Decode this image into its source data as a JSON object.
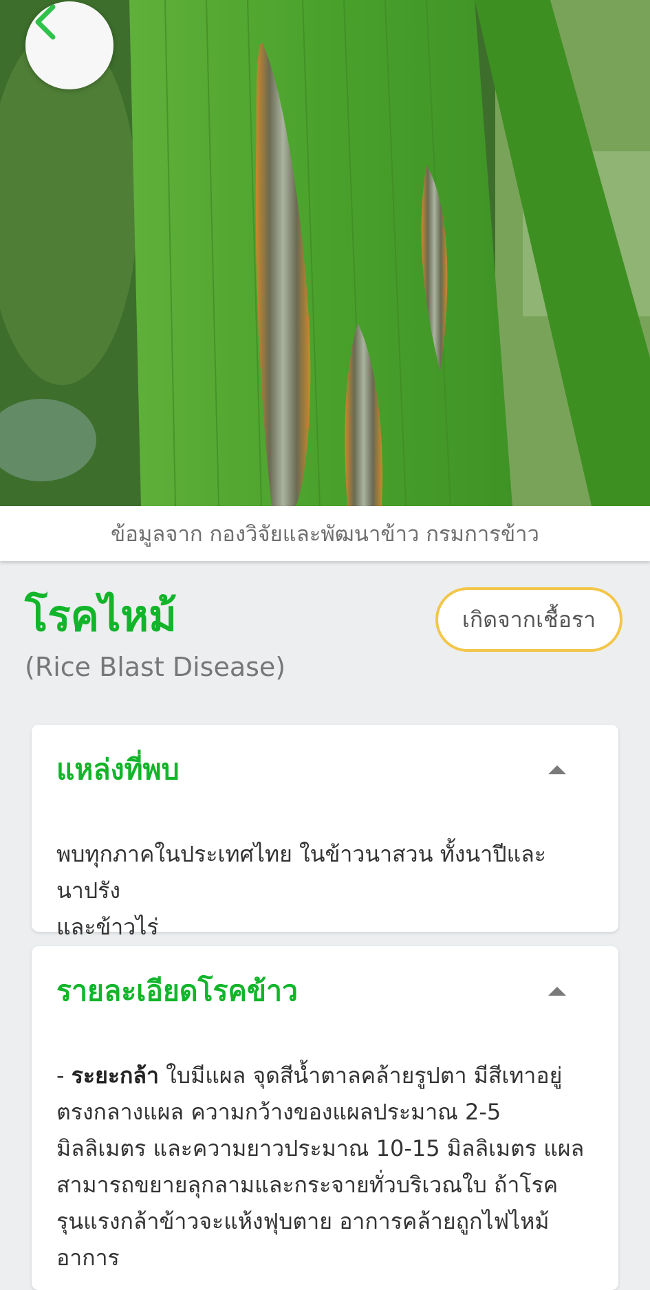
{
  "hero": {
    "image": "rice-leaf-blast-lesions",
    "back_icon": "chevron-left-icon"
  },
  "credit_text": "ข้อมูลจาก กองวิจัยและพัฒนาข้าว กรมการข้าว",
  "disease": {
    "name_th": "โรคไหม้",
    "name_en": "(Rice Blast Disease)",
    "cause_badge": "เกิดจากเชื้อรา"
  },
  "sections": [
    {
      "title": "แหล่งที่พบ",
      "expanded": true,
      "body_lines": [
        "พบทุกภาคในประเทศไทย ในข้าวนาสวน ทั้งนาปีและนาปรัง",
        "และข้าวไร่"
      ]
    },
    {
      "title": "รายละเอียดโรคข้าว",
      "expanded": true,
      "body_prefix": "- ",
      "body_bold": "ระยะกล้า",
      "body_lines": [
        " ใบมีแผล จุดสีน้ำตาลคล้ายรูปตา มีสีเทาอยู่",
        "ตรงกลางแผล ความกว้างของแผลประมาณ 2-5",
        "มิลลิเมตร และความยาวประมาณ 10-15 มิลลิเมตร แผล",
        "สามารถขยายลุกลามและกระจายทั่วบริเวณใบ ถ้าโรค",
        "รุนแรงกล้าข้าวจะแห้งฟุบตาย อาการคล้ายถูกไฟไหม้",
        "อาการ"
      ]
    }
  ],
  "colors": {
    "accent_green": "#12b52a",
    "badge_border": "#f3c64a",
    "background": "#eceef0"
  }
}
